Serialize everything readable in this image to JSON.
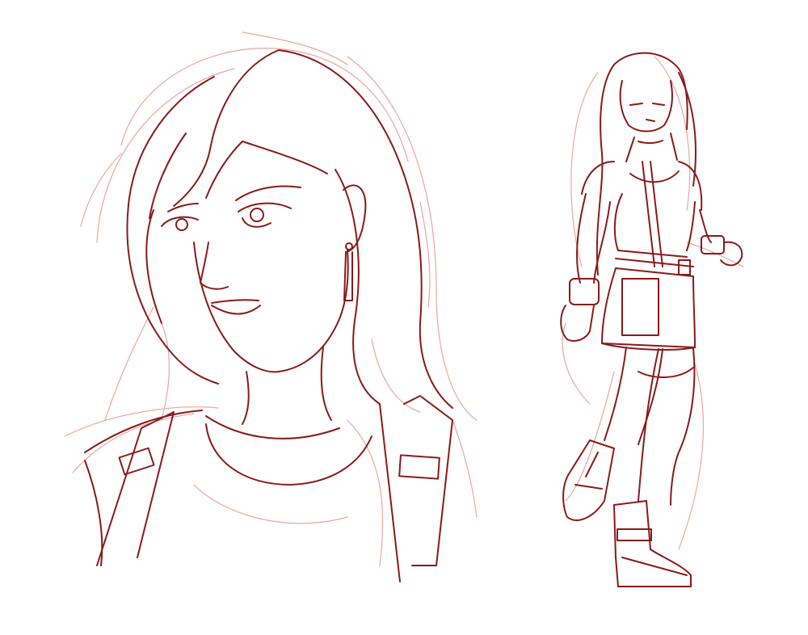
{
  "artwork": {
    "style": "pencil-sketch",
    "palette": {
      "background": "#ffffff",
      "ink_dark": "#8a1a1a",
      "ink_light": "#e08a84"
    },
    "figures": [
      "portrait-bust",
      "full-body-standing"
    ]
  }
}
